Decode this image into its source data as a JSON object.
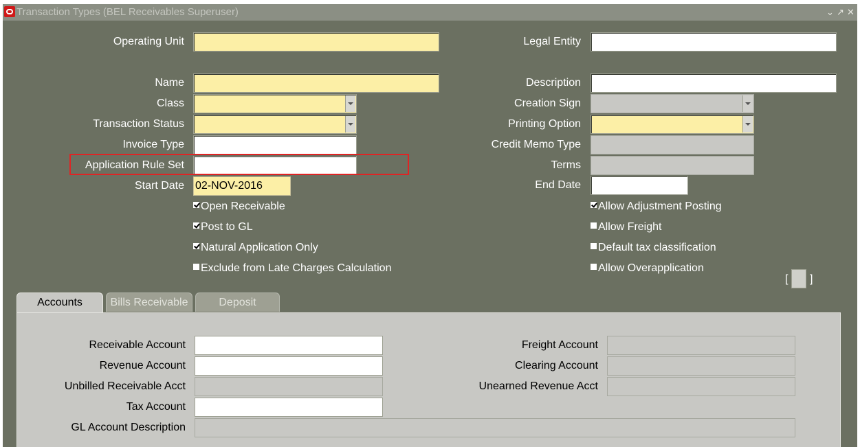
{
  "window": {
    "title": "Transaction Types (BEL Receivables Superuser)",
    "controls": [
      "⌄",
      "↗",
      "✕"
    ]
  },
  "form": {
    "operating_unit": {
      "label": "Operating Unit",
      "value": ""
    },
    "legal_entity": {
      "label": "Legal Entity",
      "value": ""
    },
    "name": {
      "label": "Name",
      "value": ""
    },
    "description": {
      "label": "Description",
      "value": ""
    },
    "class": {
      "label": "Class",
      "value": ""
    },
    "creation_sign": {
      "label": "Creation Sign",
      "value": ""
    },
    "transaction_status": {
      "label": "Transaction Status",
      "value": ""
    },
    "printing_option": {
      "label": "Printing Option",
      "value": ""
    },
    "invoice_type": {
      "label": "Invoice Type",
      "value": ""
    },
    "credit_memo_type": {
      "label": "Credit Memo Type",
      "value": ""
    },
    "application_rule_set": {
      "label": "Application Rule Set",
      "value": ""
    },
    "terms": {
      "label": "Terms",
      "value": ""
    },
    "start_date": {
      "label": "Start Date",
      "value": "02-NOV-2016"
    },
    "end_date": {
      "label": "End Date",
      "value": ""
    }
  },
  "checkboxes": {
    "open_receivable": {
      "label": "Open Receivable",
      "checked": true
    },
    "post_to_gl": {
      "label": "Post to GL",
      "checked": true
    },
    "natural_application_only": {
      "label": "Natural Application Only",
      "checked": true
    },
    "exclude_late_charges": {
      "label": "Exclude from Late Charges Calculation",
      "checked": false
    },
    "allow_adjustment_posting": {
      "label": "Allow Adjustment Posting",
      "checked": true
    },
    "allow_freight": {
      "label": "Allow Freight",
      "checked": false
    },
    "default_tax_classification": {
      "label": "Default tax classification",
      "checked": false
    },
    "allow_overapplication": {
      "label": "Allow Overapplication",
      "checked": false
    }
  },
  "brackets": {
    "open": "[",
    "close": "]"
  },
  "tabs": [
    {
      "label": "Accounts",
      "active": true
    },
    {
      "label": "Bills Receivable",
      "active": false
    },
    {
      "label": "Deposit",
      "active": false
    }
  ],
  "accounts": {
    "receivable_account": "Receivable Account",
    "revenue_account": "Revenue Account",
    "unbilled_receivable_acct": "Unbilled Receivable Acct",
    "tax_account": "Tax Account",
    "gl_account_description": "GL Account Description",
    "freight_account": "Freight Account",
    "clearing_account": "Clearing Account",
    "unearned_revenue_acct": "Unearned Revenue Acct"
  },
  "colors": {
    "required_field": "#fcefa6",
    "window_bg": "#6b7061",
    "highlight": "#e02424"
  }
}
